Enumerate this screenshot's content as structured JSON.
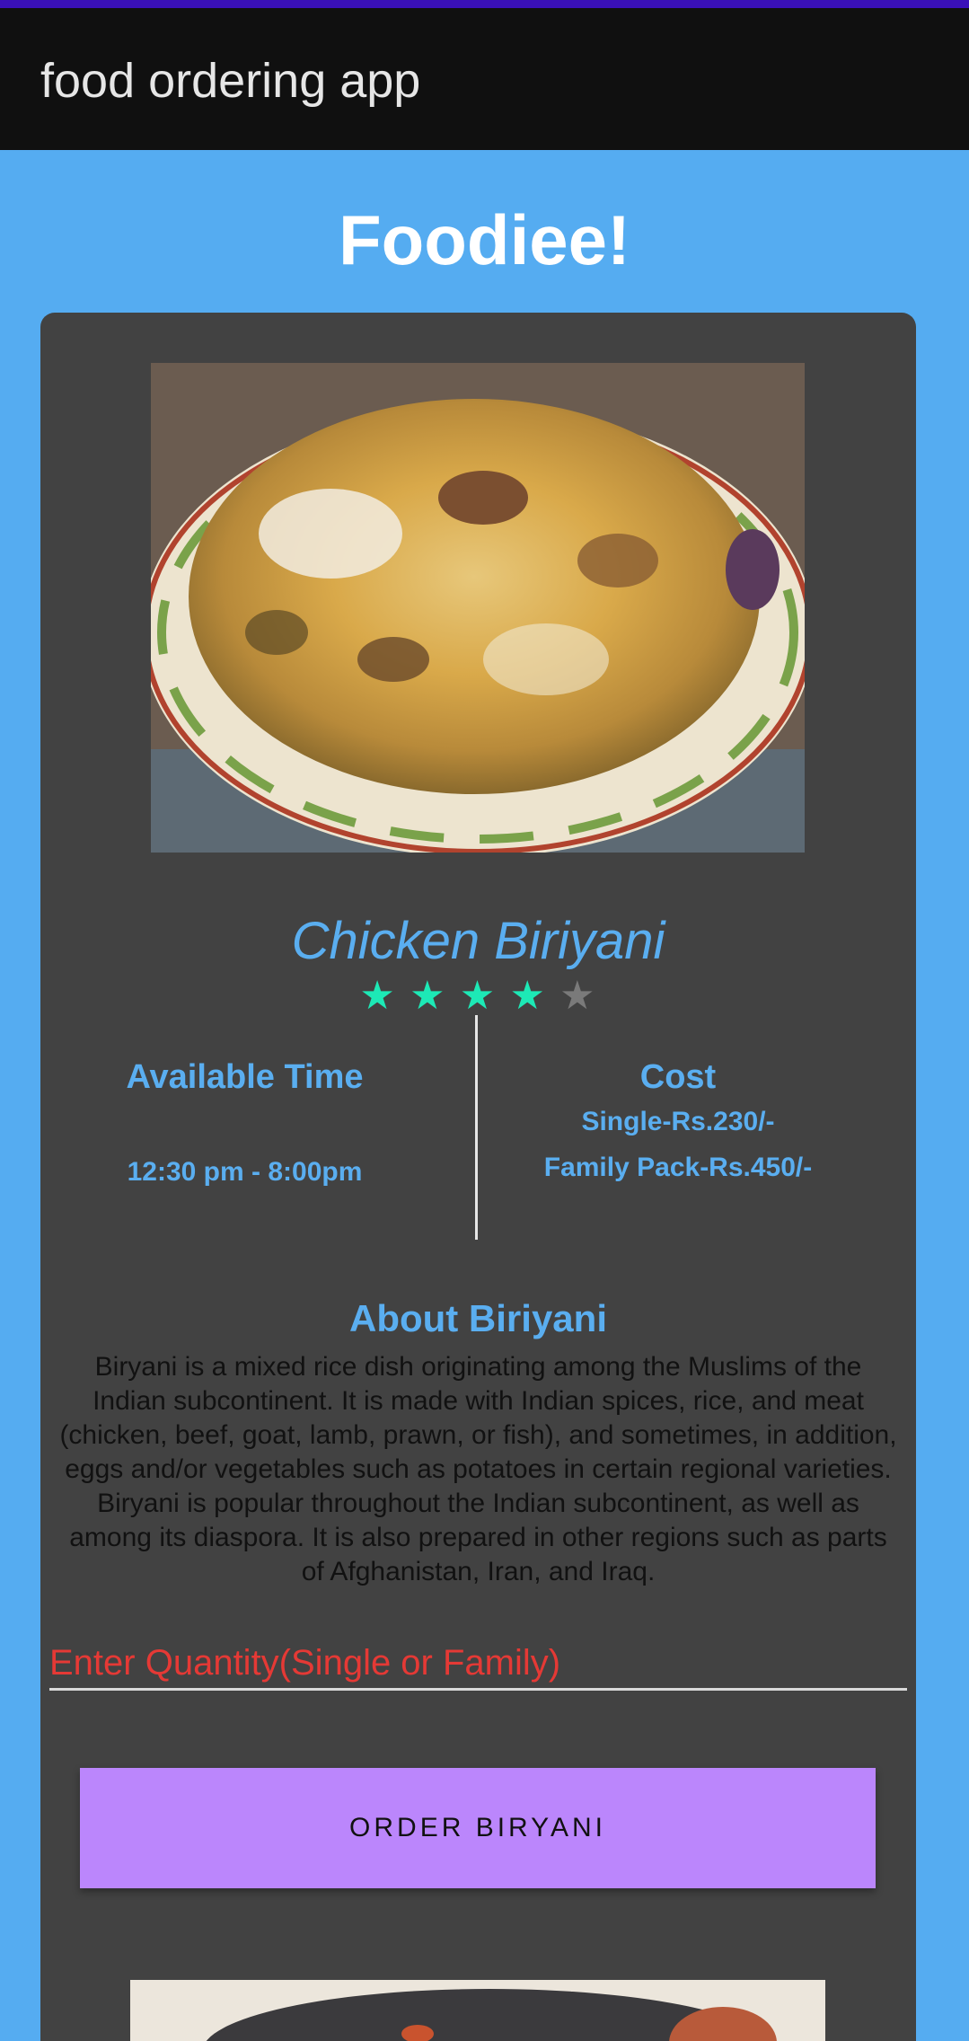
{
  "app_bar": {
    "title": "food ordering app"
  },
  "header": {
    "title": "Foodiee!"
  },
  "dish": {
    "name": "Chicken Biriyani",
    "rating": {
      "value": 4,
      "max": 5
    },
    "availability": {
      "label": "Available Time",
      "time": "12:30 pm - 8:00pm"
    },
    "cost": {
      "label": "Cost",
      "single": "Single-Rs.230/-",
      "family": "Family Pack-Rs.450/-"
    },
    "about": {
      "title": "About Biriyani",
      "text": "Biryani is a mixed rice dish originating among the Muslims of the Indian subcontinent. It is made with Indian spices, rice, and meat (chicken, beef, goat, lamb, prawn, or fish), and sometimes, in addition, eggs and/or vegetables such as potatoes in certain regional varieties. Biryani is popular throughout the Indian subcontinent, as well as among its diaspora. It is also prepared in other regions such as parts of Afghanistan, Iran, and Iraq."
    }
  },
  "order_form": {
    "quantity_placeholder": "Enter Quantity(Single or Family)",
    "quantity_value": "",
    "order_button_label": "ORDER BIRYANI"
  },
  "colors": {
    "background": "#55acf1",
    "app_bar": "#101010",
    "card": "#424242",
    "accent_text": "#5aaef0",
    "star_filled": "#1de9b6",
    "star_empty": "#7a7a7a",
    "input_hint": "#e53935",
    "button": "#bb86fc"
  },
  "icons": {
    "rating": "star-icon"
  }
}
